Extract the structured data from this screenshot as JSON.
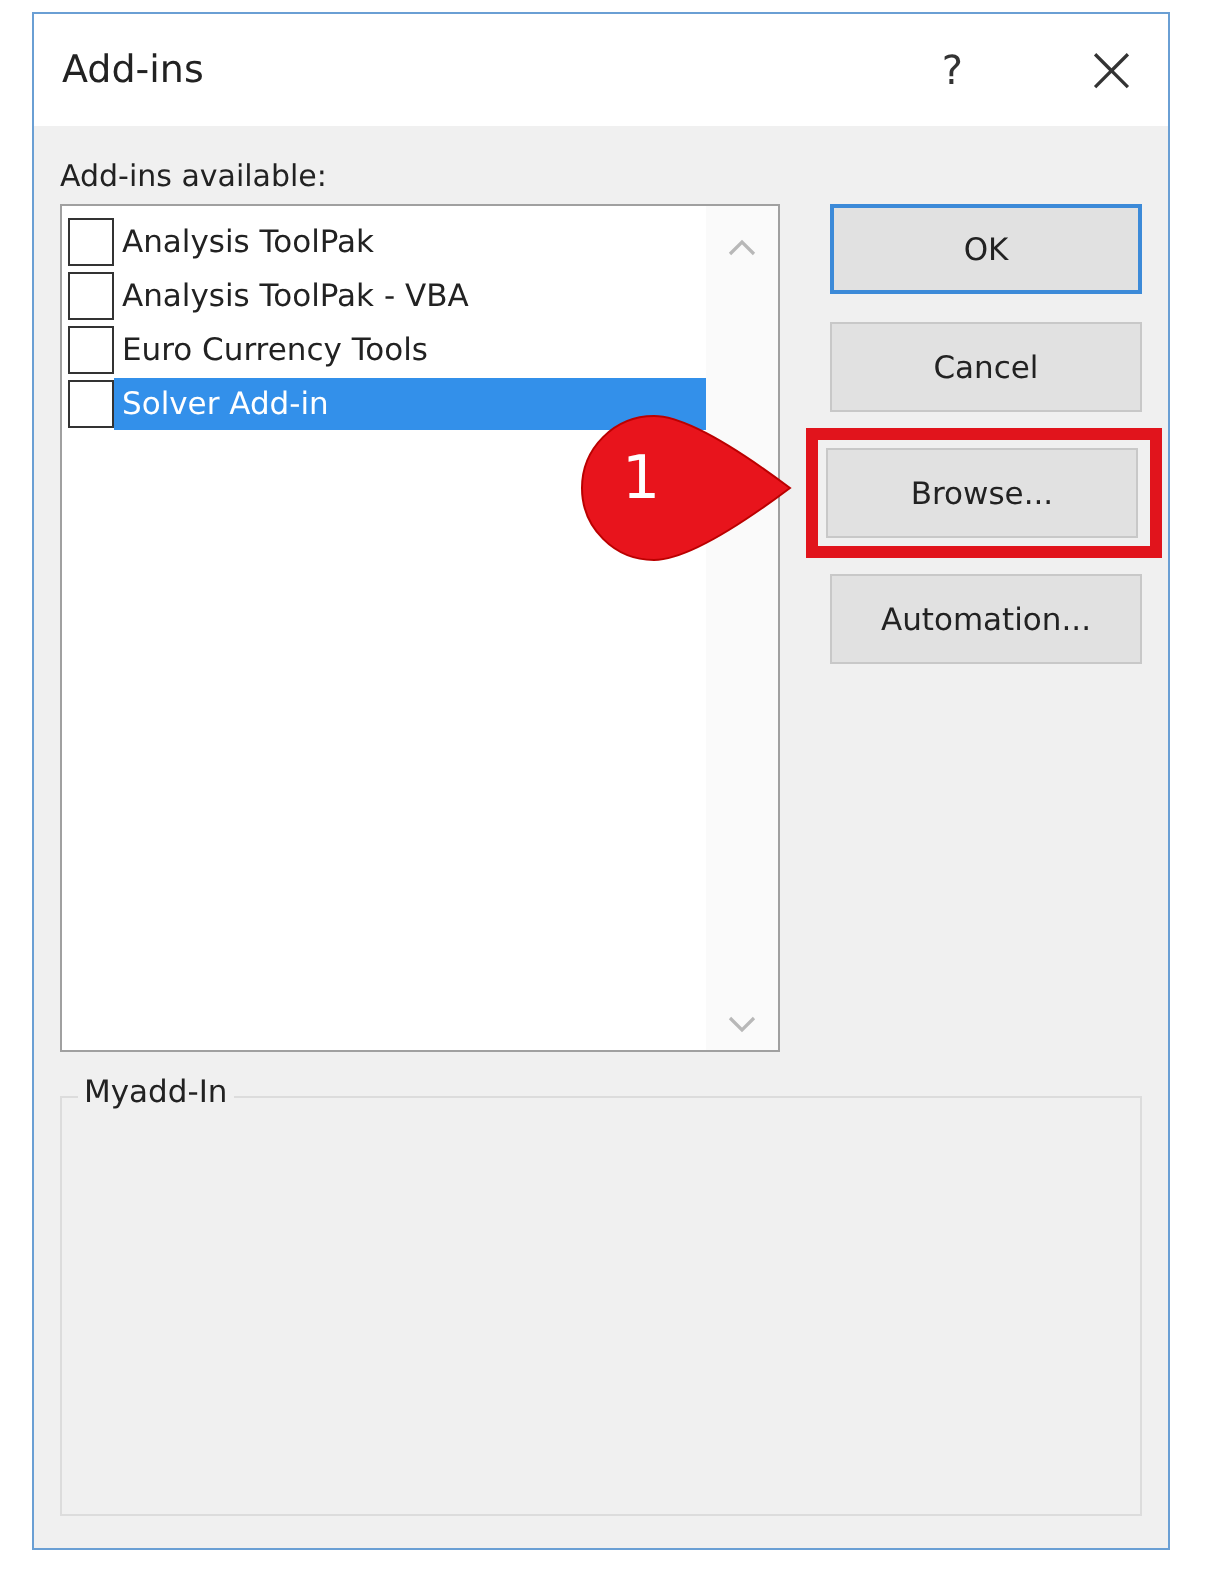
{
  "window": {
    "title": "Add-ins",
    "help": "?",
    "close": "×"
  },
  "list_label": "Add-ins available:",
  "addins": [
    {
      "name": "Analysis ToolPak",
      "checked": false,
      "selected": false
    },
    {
      "name": "Analysis ToolPak - VBA",
      "checked": false,
      "selected": false
    },
    {
      "name": "Euro Currency Tools",
      "checked": false,
      "selected": false
    },
    {
      "name": "Solver Add-in",
      "checked": false,
      "selected": true
    }
  ],
  "buttons": [
    {
      "label": "OK",
      "kind": "default",
      "highlighted": false
    },
    {
      "label": "Cancel",
      "kind": "normal",
      "highlighted": false
    },
    {
      "label": "Browse...",
      "kind": "normal",
      "highlighted": true
    },
    {
      "label": "Automation...",
      "kind": "normal",
      "highlighted": false
    }
  ],
  "callout": {
    "number": "1"
  },
  "group": {
    "title": "Myadd-In"
  }
}
